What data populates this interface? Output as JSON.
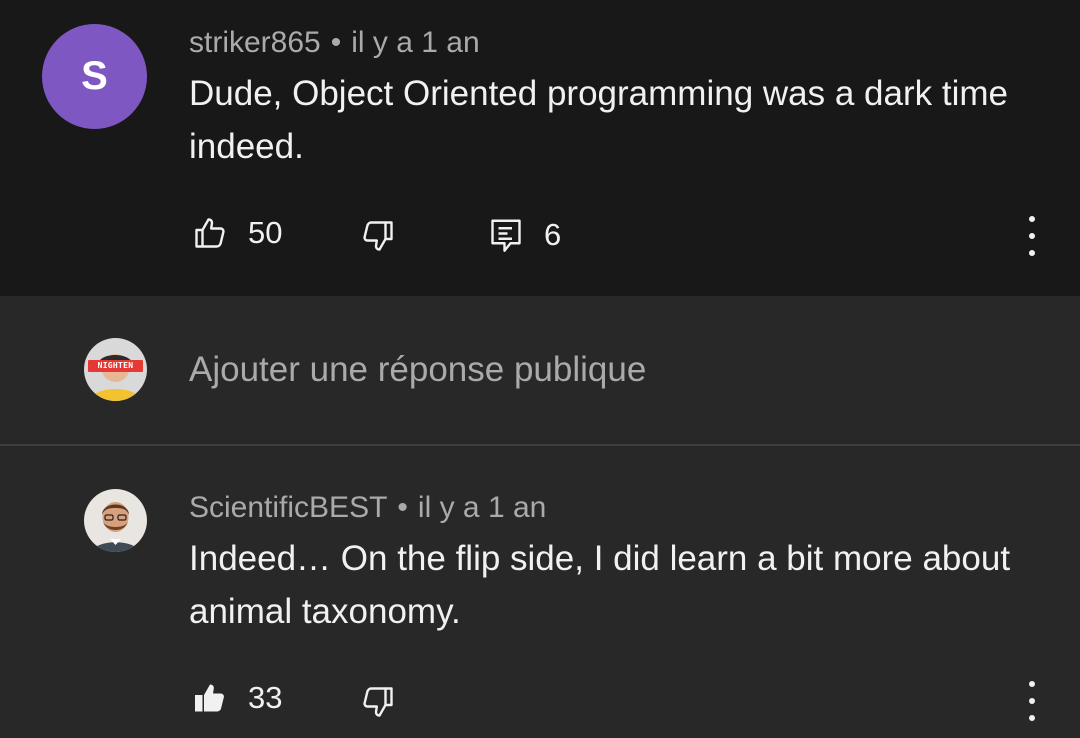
{
  "comment": {
    "avatar_letter": "S",
    "author": "striker865",
    "separator": "•",
    "time": "il y a 1 an",
    "text": "Dude, Object Oriented programming was a dark time indeed.",
    "like_count": "50",
    "reply_count": "6",
    "avatar_color": "#7e57c2"
  },
  "reply_box": {
    "placeholder": "Ajouter une réponse publique",
    "avatar_badge": "NIGHTEN"
  },
  "reply": {
    "author": "ScientificBEST",
    "separator": "•",
    "time": "il y a 1 an",
    "text": "Indeed… On the flip side, I did learn a bit more about animal taxonomy.",
    "like_count": "33"
  },
  "icons": {
    "like": "thumb-up-outline-icon",
    "like_filled": "thumb-up-filled-icon",
    "dislike": "thumb-down-outline-icon",
    "replies": "comment-icon",
    "more": "more-vertical-icon"
  }
}
